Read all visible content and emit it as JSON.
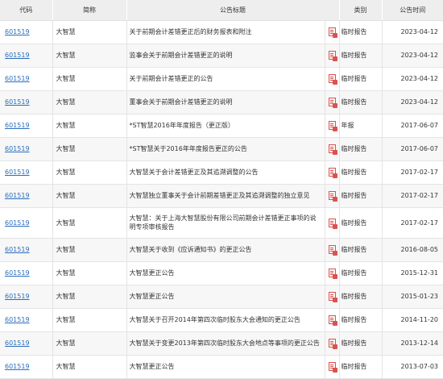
{
  "columns": {
    "code": "代码",
    "name": "简称",
    "title": "公告标题",
    "type": "类别",
    "date": "公告时间"
  },
  "rows": [
    {
      "code": "601519",
      "name": "大智慧",
      "title": "关于前期会计差错更正后的财务报表和附注",
      "type": "临时报告",
      "date": "2023-04-12"
    },
    {
      "code": "601519",
      "name": "大智慧",
      "title": "监事会关于前期会计差错更正的说明",
      "type": "临时报告",
      "date": "2023-04-12"
    },
    {
      "code": "601519",
      "name": "大智慧",
      "title": "关于前期会计差错更正的公告",
      "type": "临时报告",
      "date": "2023-04-12"
    },
    {
      "code": "601519",
      "name": "大智慧",
      "title": "董事会关于前期会计差错更正的说明",
      "type": "临时报告",
      "date": "2023-04-12"
    },
    {
      "code": "601519",
      "name": "大智慧",
      "title": "*ST智慧2016年年度报告（更正版）",
      "type": "年报",
      "date": "2017-06-07"
    },
    {
      "code": "601519",
      "name": "大智慧",
      "title": "*ST智慧关于2016年年度报告更正的公告",
      "type": "临时报告",
      "date": "2017-06-07"
    },
    {
      "code": "601519",
      "name": "大智慧",
      "title": "大智慧关于会计差错更正及其追溯调整的公告",
      "type": "临时报告",
      "date": "2017-02-17"
    },
    {
      "code": "601519",
      "name": "大智慧",
      "title": "大智慧独立董事关于会计前期差错更正及其追溯调整的独立意见",
      "type": "临时报告",
      "date": "2017-02-17"
    },
    {
      "code": "601519",
      "name": "大智慧",
      "title": "大智慧：关于上海大智慧股份有限公司前期会计差错更正事项的说明专项审核报告",
      "type": "临时报告",
      "date": "2017-02-17"
    },
    {
      "code": "601519",
      "name": "大智慧",
      "title": "大智慧关于收到《应诉通知书》的更正公告",
      "type": "临时报告",
      "date": "2016-08-05"
    },
    {
      "code": "601519",
      "name": "大智慧",
      "title": "大智慧更正公告",
      "type": "临时报告",
      "date": "2015-12-31"
    },
    {
      "code": "601519",
      "name": "大智慧",
      "title": "大智慧更正公告",
      "type": "临时报告",
      "date": "2015-01-23"
    },
    {
      "code": "601519",
      "name": "大智慧",
      "title": "大智慧关于召开2014年第四次临时股东大会通知的更正公告",
      "type": "临时报告",
      "date": "2014-11-20"
    },
    {
      "code": "601519",
      "name": "大智慧",
      "title": "大智慧关于变更2013年第四次临时股东大会地点等事项的更正公告",
      "type": "临时报告",
      "date": "2013-12-14"
    },
    {
      "code": "601519",
      "name": "大智慧",
      "title": "大智慧更正公告",
      "type": "临时报告",
      "date": "2013-07-03"
    }
  ],
  "icons": {
    "pdf": "pdf-file-icon"
  },
  "colors": {
    "link": "#2a6ebb",
    "header_bg": "#eeeeee",
    "icon_red": "#d9534f"
  }
}
